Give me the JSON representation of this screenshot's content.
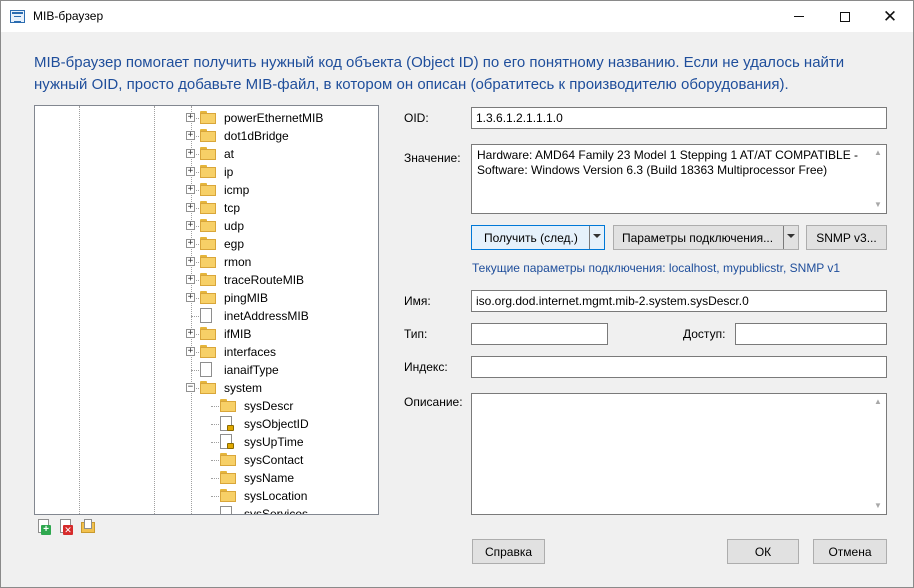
{
  "window": {
    "title": "MIB-браузер",
    "controls": {
      "minimize": "minimize-icon",
      "maximize": "maximize-icon",
      "close": "✕"
    }
  },
  "description": "MIB-браузер помогает получить нужный код объекта (Object ID) по его понятному названию. Если не удалось найти нужный OID, просто добавьте MIB-файл, в котором он описан (обратитесь к производителю оборудования).",
  "tree": {
    "items": [
      {
        "label": "powerEthernetMIB",
        "level": 1,
        "type": "folder",
        "expander": "+"
      },
      {
        "label": "dot1dBridge",
        "level": 1,
        "type": "folder",
        "expander": "+"
      },
      {
        "label": "at",
        "level": 1,
        "type": "folder",
        "expander": "+"
      },
      {
        "label": "ip",
        "level": 1,
        "type": "folder",
        "expander": "+"
      },
      {
        "label": "icmp",
        "level": 1,
        "type": "folder",
        "expander": "+"
      },
      {
        "label": "tcp",
        "level": 1,
        "type": "folder",
        "expander": "+"
      },
      {
        "label": "udp",
        "level": 1,
        "type": "folder",
        "expander": "+"
      },
      {
        "label": "egp",
        "level": 1,
        "type": "folder",
        "expander": "+"
      },
      {
        "label": "rmon",
        "level": 1,
        "type": "folder",
        "expander": "+"
      },
      {
        "label": "traceRouteMIB",
        "level": 1,
        "type": "folder",
        "expander": "+"
      },
      {
        "label": "pingMIB",
        "level": 1,
        "type": "folder",
        "expander": "+"
      },
      {
        "label": "inetAddressMIB",
        "level": 1,
        "type": "leaf",
        "expander": ""
      },
      {
        "label": "ifMIB",
        "level": 1,
        "type": "folder",
        "expander": "+"
      },
      {
        "label": "interfaces",
        "level": 1,
        "type": "folder",
        "expander": "+"
      },
      {
        "label": "ianaifType",
        "level": 1,
        "type": "leaf",
        "expander": ""
      },
      {
        "label": "system",
        "level": 1,
        "type": "folder",
        "expander": "−"
      },
      {
        "label": "sysDescr",
        "level": 2,
        "type": "folder",
        "expander": ""
      },
      {
        "label": "sysObjectID",
        "level": 2,
        "type": "leaf-lock",
        "expander": ""
      },
      {
        "label": "sysUpTime",
        "level": 2,
        "type": "leaf-lock",
        "expander": ""
      },
      {
        "label": "sysContact",
        "level": 2,
        "type": "folder",
        "expander": ""
      },
      {
        "label": "sysName",
        "level": 2,
        "type": "folder",
        "expander": ""
      },
      {
        "label": "sysLocation",
        "level": 2,
        "type": "folder",
        "expander": ""
      },
      {
        "label": "sysServices",
        "level": 2,
        "type": "leaf",
        "expander": ""
      }
    ],
    "scroll_position": 0.4,
    "tools": [
      "add-mib-icon",
      "remove-mib-icon",
      "open-mib-folder-icon"
    ]
  },
  "form": {
    "oid_label": "OID:",
    "oid_value": "1.3.6.1.2.1.1.1.0",
    "value_label": "Значение:",
    "value_text": "Hardware: AMD64 Family 23 Model 1 Stepping 1 AT/AT COMPATIBLE - Software: Windows Version 6.3 (Build 18363 Multiprocessor Free)",
    "get_button": "Получить (след.)",
    "conn_params_button": "Параметры подключения...",
    "snmpv3_button": "SNMP v3...",
    "current_params_link": "Текущие параметры подключения: localhost, mypublicstr, SNMP v1",
    "name_label": "Имя:",
    "name_value": "iso.org.dod.internet.mgmt.mib-2.system.sysDescr.0",
    "type_label": "Тип:",
    "type_value": "",
    "access_label": "Доступ:",
    "access_value": "",
    "index_label": "Индекс:",
    "index_value": "",
    "description_label": "Описание:",
    "description_value": ""
  },
  "footer": {
    "help_button": "Справка",
    "ok_button": "ОК",
    "cancel_button": "Отмена"
  },
  "colors": {
    "accent_text": "#1f4e9b",
    "primary_border": "#0078d7",
    "folder": "#f7d067"
  }
}
